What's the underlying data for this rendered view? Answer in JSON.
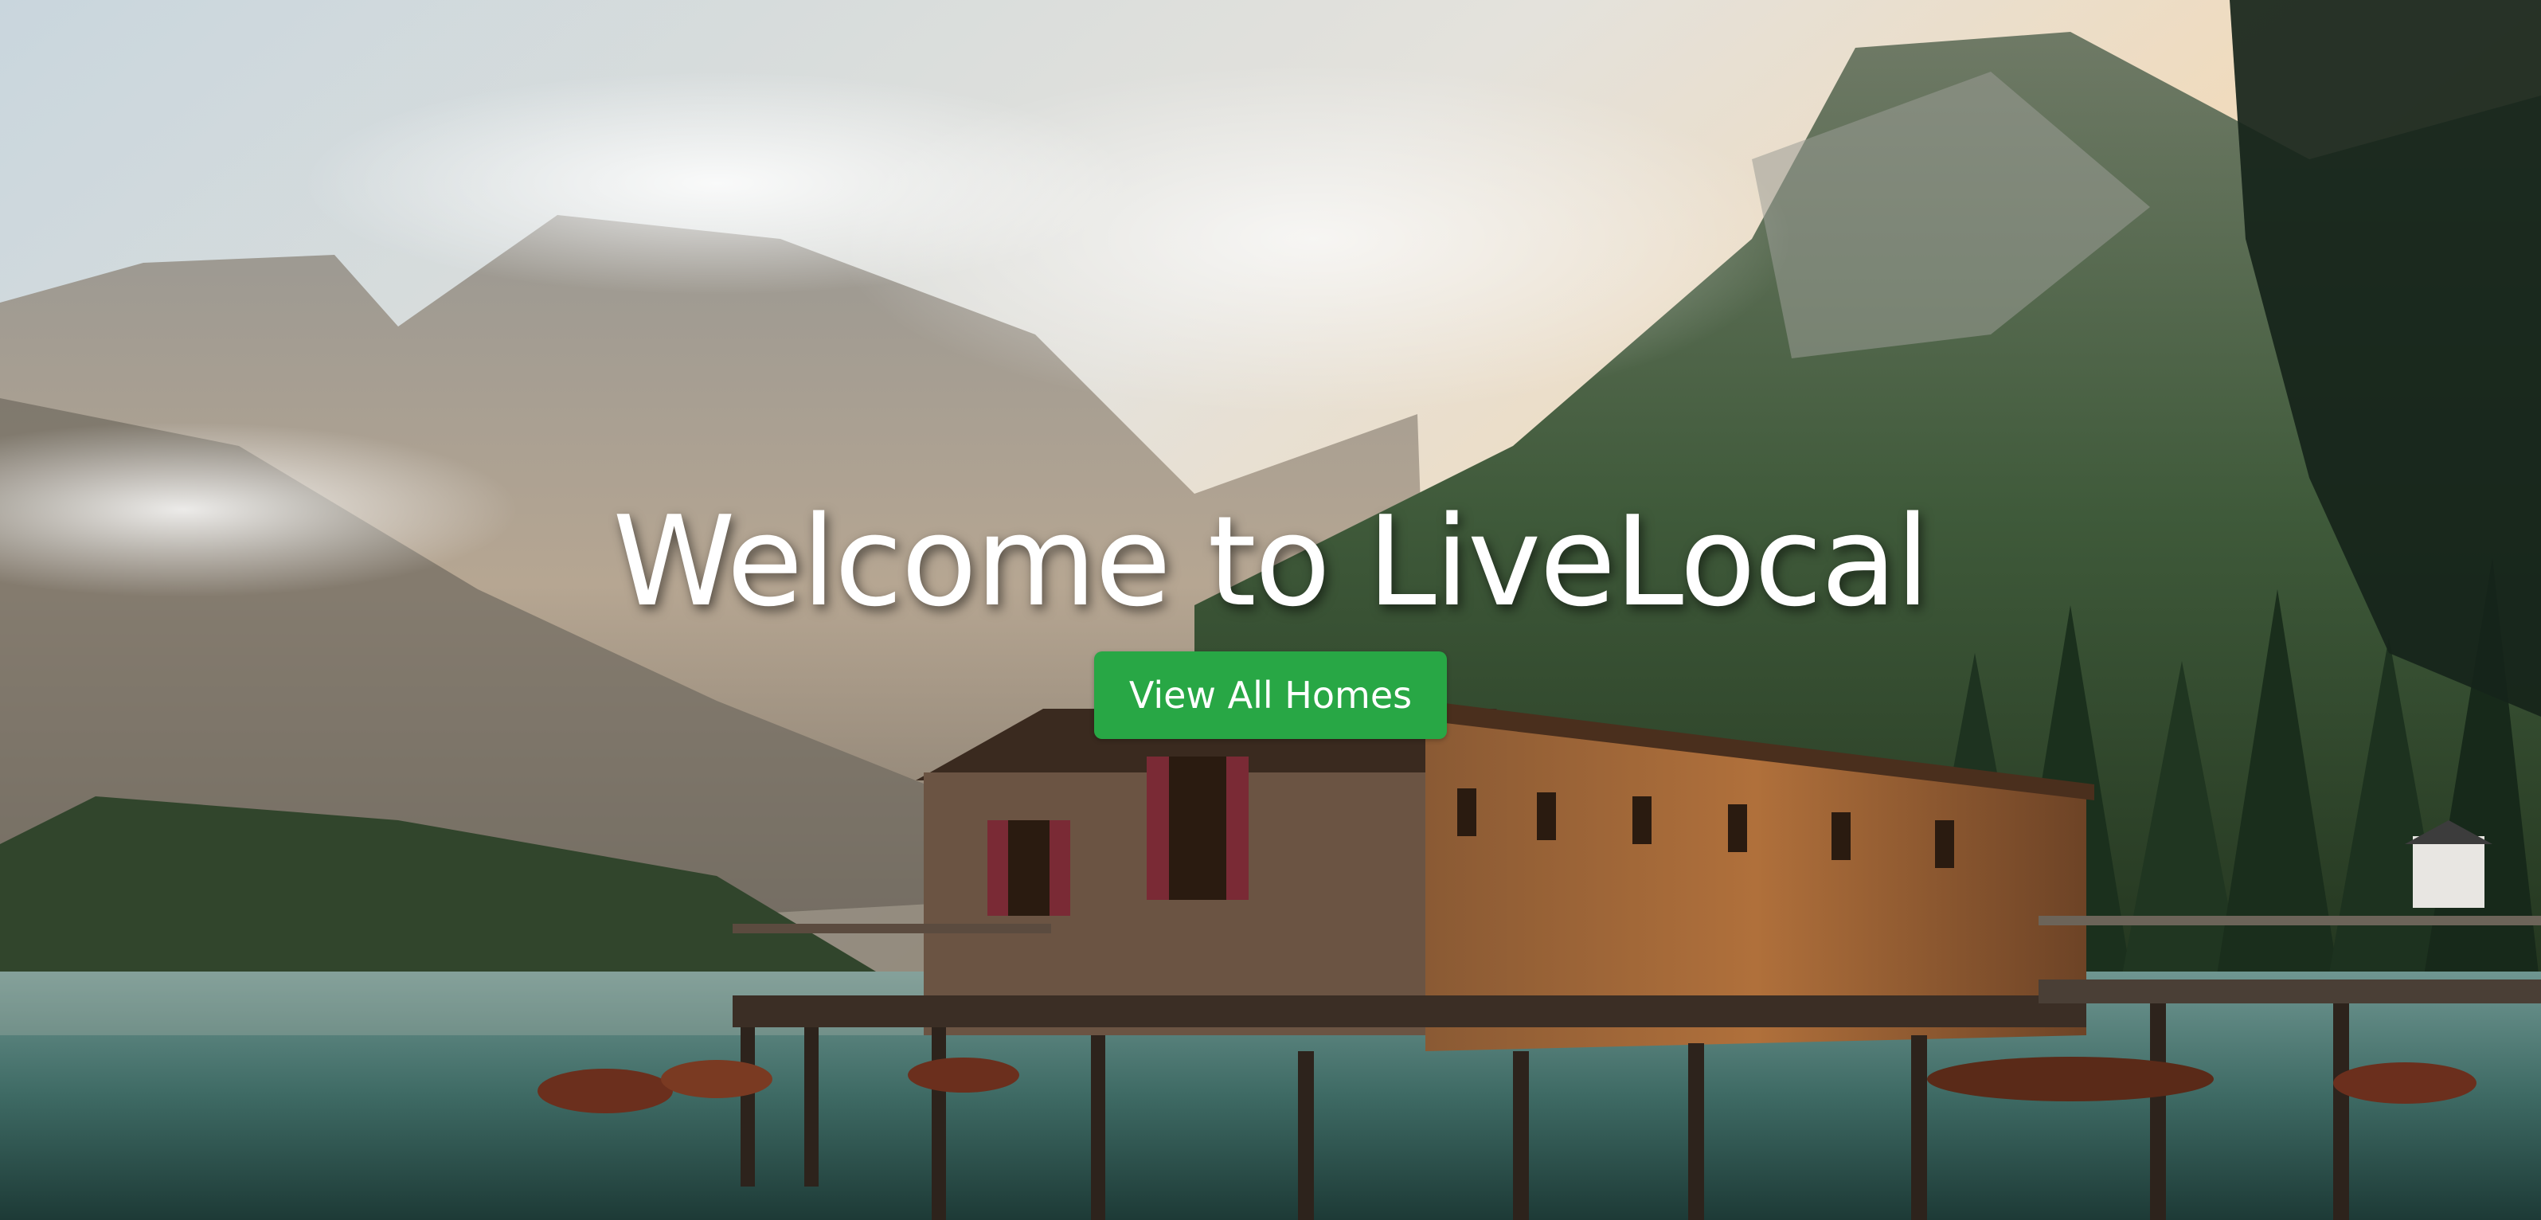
{
  "hero": {
    "title": "Welcome to LiveLocal",
    "button_label": "View All Homes",
    "button_color": "#28a745",
    "background_image": "mountain lake boathouse with rowboats and pine forest"
  }
}
